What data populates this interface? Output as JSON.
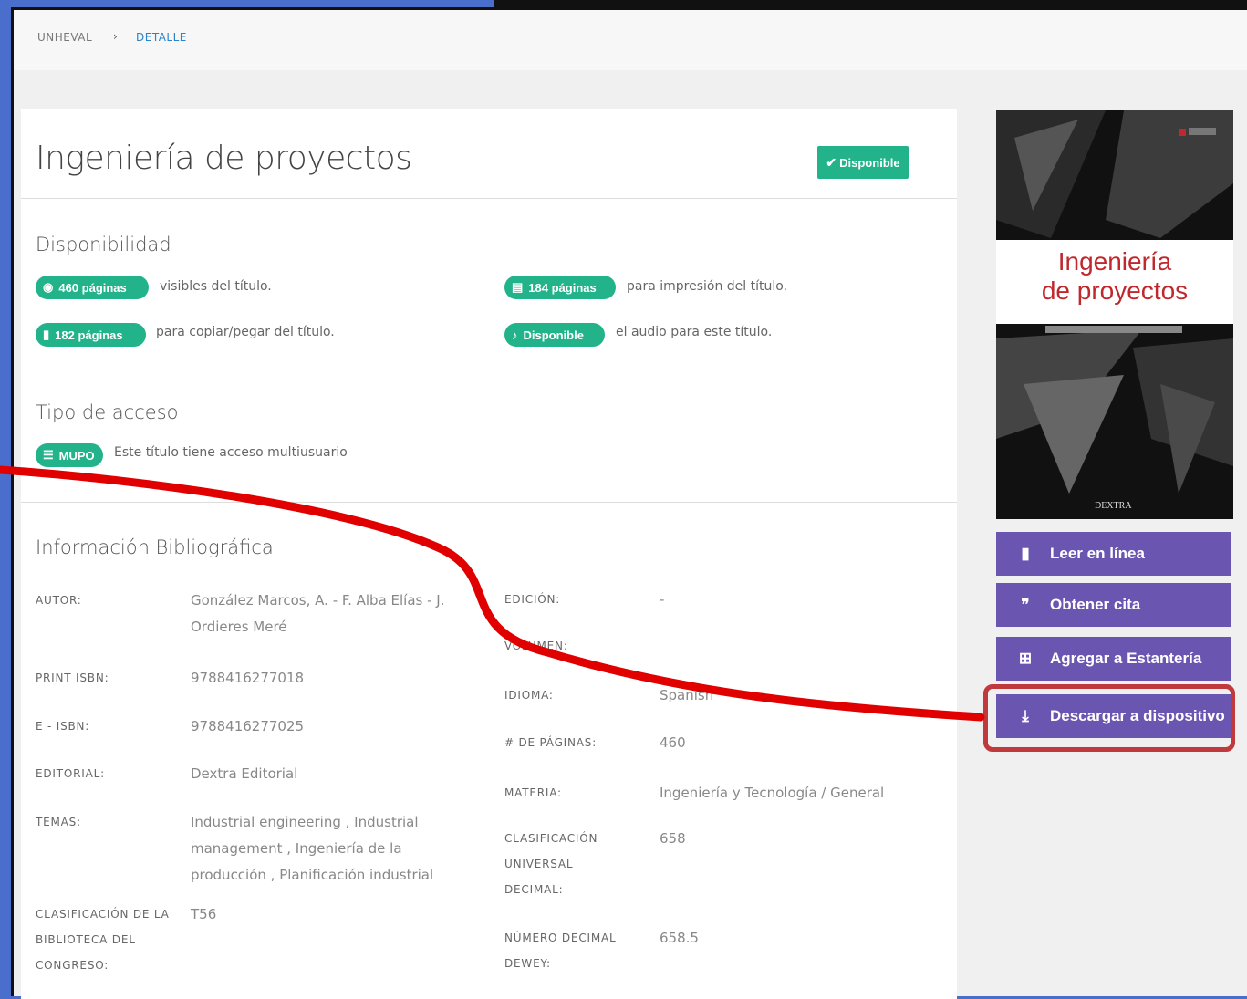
{
  "breadcrumb": {
    "home": "UNHEVAL",
    "separator": "›",
    "current": "DETALLE"
  },
  "book": {
    "title": "Ingeniería de proyectos",
    "status_badge": "Disponible"
  },
  "availability": {
    "heading": "Disponibilidad",
    "items": [
      {
        "icon": "eye-icon",
        "pill": "460 páginas",
        "text": "visibles del título."
      },
      {
        "icon": "print-icon",
        "pill": "184 páginas",
        "text": "para impresión del título."
      },
      {
        "icon": "copy-icon",
        "pill": "182 páginas",
        "text": "para copiar/pegar del título."
      },
      {
        "icon": "audio-icon",
        "pill": "Disponible",
        "text": "el audio para este título."
      }
    ]
  },
  "access": {
    "heading": "Tipo de acceso",
    "pill": "MUPO",
    "text": "Este título tiene acceso multiusuario"
  },
  "bibliography": {
    "heading": "Información Bibliográfica",
    "left": [
      {
        "label": "AUTOR:",
        "value": "González Marcos, A. - F. Alba Elías - J. Ordieres Meré"
      },
      {
        "label": "PRINT ISBN:",
        "value": "9788416277018"
      },
      {
        "label": "E - ISBN:",
        "value": "9788416277025"
      },
      {
        "label": "EDITORIAL:",
        "value": "Dextra Editorial"
      },
      {
        "label": "TEMAS:",
        "value": "Industrial engineering , Industrial management , Ingeniería de la producción , Planificación industrial"
      },
      {
        "label": "CLASIFICACIÓN DE LA BIBLIOTECA DEL CONGRESO:",
        "value": "T56"
      }
    ],
    "right": [
      {
        "label": "EDICIÓN:",
        "value": "-"
      },
      {
        "label": "VOLUMEN:",
        "value": ""
      },
      {
        "label": "IDIOMA:",
        "value": "Spanish"
      },
      {
        "label": "# DE PÁGINAS:",
        "value": "460"
      },
      {
        "label": "MATERIA:",
        "value": "Ingeniería y Tecnología / General"
      },
      {
        "label": "CLASIFICACIÓN UNIVERSAL DECIMAL:",
        "value": "658"
      },
      {
        "label": "NÚMERO DECIMAL DEWEY:",
        "value": "658.5"
      }
    ]
  },
  "cover": {
    "title_line1": "Ingeniería",
    "title_line2": "de proyectos",
    "publisher": "DEXTRA"
  },
  "actions": [
    {
      "icon": "tablet-icon",
      "label": "Leer en línea"
    },
    {
      "icon": "quote-icon",
      "label": "Obtener cita"
    },
    {
      "icon": "shelf-add-icon",
      "label": "Agregar a Estantería"
    },
    {
      "icon": "download-icon",
      "label": "Descargar a dispositivo"
    }
  ],
  "colors": {
    "accent_green": "#22b38b",
    "button_purple": "#6a55b1",
    "annotation_red": "#e00000",
    "highlight_red": "#c0393d"
  }
}
